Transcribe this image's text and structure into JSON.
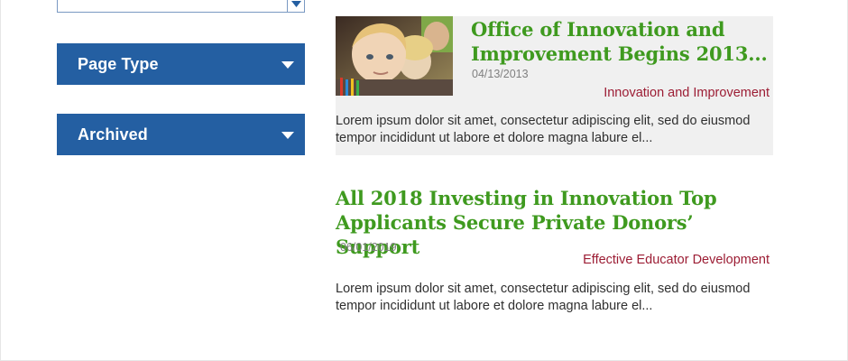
{
  "sidebar": {
    "select": {
      "value": ""
    },
    "filters": [
      {
        "label": "Page Type"
      },
      {
        "label": "Archived"
      }
    ]
  },
  "articles": [
    {
      "title": "Office of Innovation and Improvement Begins 2013...",
      "date": "04/13/2013",
      "category": "Innovation and Improvement",
      "excerpt": "Lorem ipsum dolor sit amet, consectetur adipiscing elit, sed do eiusmod tempor incididunt ut labore et dolore magna labure el..."
    },
    {
      "title": "All 2018 Investing in Innovation Top Applicants Secure Private Donors’ Support",
      "date": "06/01/2019",
      "category": "Effective Educator Development",
      "excerpt": "Lorem ipsum dolor sit amet, consectetur adipiscing elit, sed do eiusmod tempor incididunt ut labore et dolore magna labure el..."
    }
  ],
  "colors": {
    "filter_bg": "#245fa2",
    "title": "#3f9a1f",
    "category": "#9c1d34",
    "card_bg": "#f0f0f0"
  },
  "icons": {
    "select_arrow": "chevron-down-icon",
    "filter_caret": "caret-down-icon",
    "thumbnail": "children-photo"
  }
}
